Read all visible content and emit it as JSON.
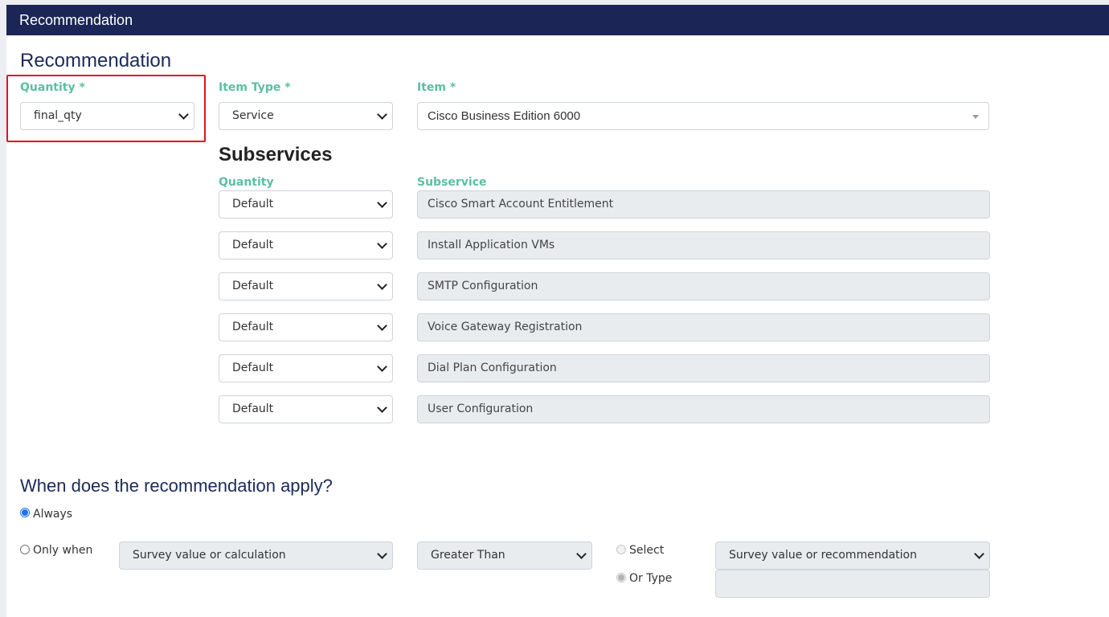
{
  "header": {
    "title": "Recommendation"
  },
  "section_title": "Recommendation",
  "quantity": {
    "label": "Quantity *",
    "value": "final_qty"
  },
  "item_type": {
    "label": "Item Type *",
    "value": "Service"
  },
  "item": {
    "label": "Item *",
    "value": "Cisco Business Edition 6000"
  },
  "subservices": {
    "title": "Subservices",
    "quantity_header": "Quantity",
    "subservice_header": "Subservice",
    "rows": [
      {
        "quantity": "Default",
        "name": "Cisco Smart Account Entitlement"
      },
      {
        "quantity": "Default",
        "name": "Install Application VMs"
      },
      {
        "quantity": "Default",
        "name": "SMTP Configuration"
      },
      {
        "quantity": "Default",
        "name": "Voice Gateway Registration"
      },
      {
        "quantity": "Default",
        "name": "Dial Plan Configuration"
      },
      {
        "quantity": "Default",
        "name": "User Configuration"
      }
    ]
  },
  "conditions": {
    "title": "When does the recommendation apply?",
    "always_label": "Always",
    "always_checked": true,
    "only_when_label": "Only when",
    "only_when_checked": false,
    "survey_select": "Survey value or calculation",
    "operator_select": "Greater Than",
    "select_label": "Select",
    "or_type_label": "Or Type",
    "or_type_checked": true,
    "value_select": "Survey value or recommendation",
    "type_value": ""
  },
  "colors": {
    "header_bg": "#1b2656",
    "label": "#5bbfa3",
    "highlight": "#e0141e"
  }
}
